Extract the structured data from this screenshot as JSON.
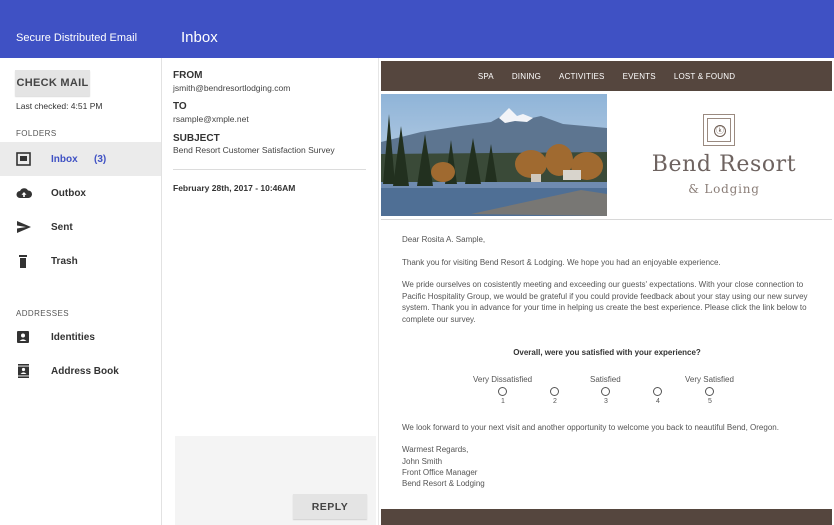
{
  "header": {
    "app_title": "Secure Distributed Email",
    "page_title": "Inbox"
  },
  "sidebar": {
    "check_mail_label": "CHECK MAIL",
    "last_checked": "Last checked: 4:51 PM",
    "folders_label": "FOLDERS",
    "folders": [
      {
        "label": "Inbox",
        "count": "(3)",
        "icon": "inbox-icon"
      },
      {
        "label": "Outbox",
        "icon": "cloud-upload-icon"
      },
      {
        "label": "Sent",
        "icon": "send-icon"
      },
      {
        "label": "Trash",
        "icon": "trash-icon"
      }
    ],
    "addresses_label": "ADDRESSES",
    "addresses": [
      {
        "label": "Identities",
        "icon": "identity-icon"
      },
      {
        "label": "Address Book",
        "icon": "address-book-icon"
      }
    ]
  },
  "message": {
    "from_label": "FROM",
    "from": "jsmith@bendresortlodging.com",
    "to_label": "TO",
    "to": "rsample@xmple.net",
    "subject_label": "SUBJECT",
    "subject": "Bend Resort Customer Satisfaction Survey",
    "date": "February 28th, 2017 - 10:46AM",
    "reply_label": "REPLY"
  },
  "email": {
    "nav": [
      "SPA",
      "DINING",
      "ACTIVITIES",
      "EVENTS",
      "LOST & FOUND"
    ],
    "brand_name": "Bend Resort",
    "brand_sub": "& Lodging",
    "greeting": "Dear Rosita A. Sample,",
    "para1": "Thank you for visiting Bend  Resort & Lodging. We hope you had an enjoyable experience.",
    "para2": "We pride ourselves on cosistently meeting and exceeding our guests' expectations. With your close connection to Pacific Hospitality Group, we would be grateful if you could provide feedback about your stay using our new survey system. Thank you in advance for your time in helping us create the best experience. Please click the link below to complete our survey.",
    "question": "Overall, were you satisfied with your experience?",
    "scale_low": "Very Dissatisfied",
    "scale_mid": "Satisfied",
    "scale_high": "Very Satisfied",
    "options": [
      "1",
      "2",
      "3",
      "4",
      "5"
    ],
    "closing": "We look forward to your next visit and another opportunity to welcome you back to neautiful Bend, Oregon.",
    "signoff": [
      "Warmest Regards,",
      "John Smith",
      "Front Office Manager",
      "Bend Resort & Lodging"
    ]
  },
  "colors": {
    "primary": "#3f51c4",
    "email_brown": "#55463e"
  }
}
